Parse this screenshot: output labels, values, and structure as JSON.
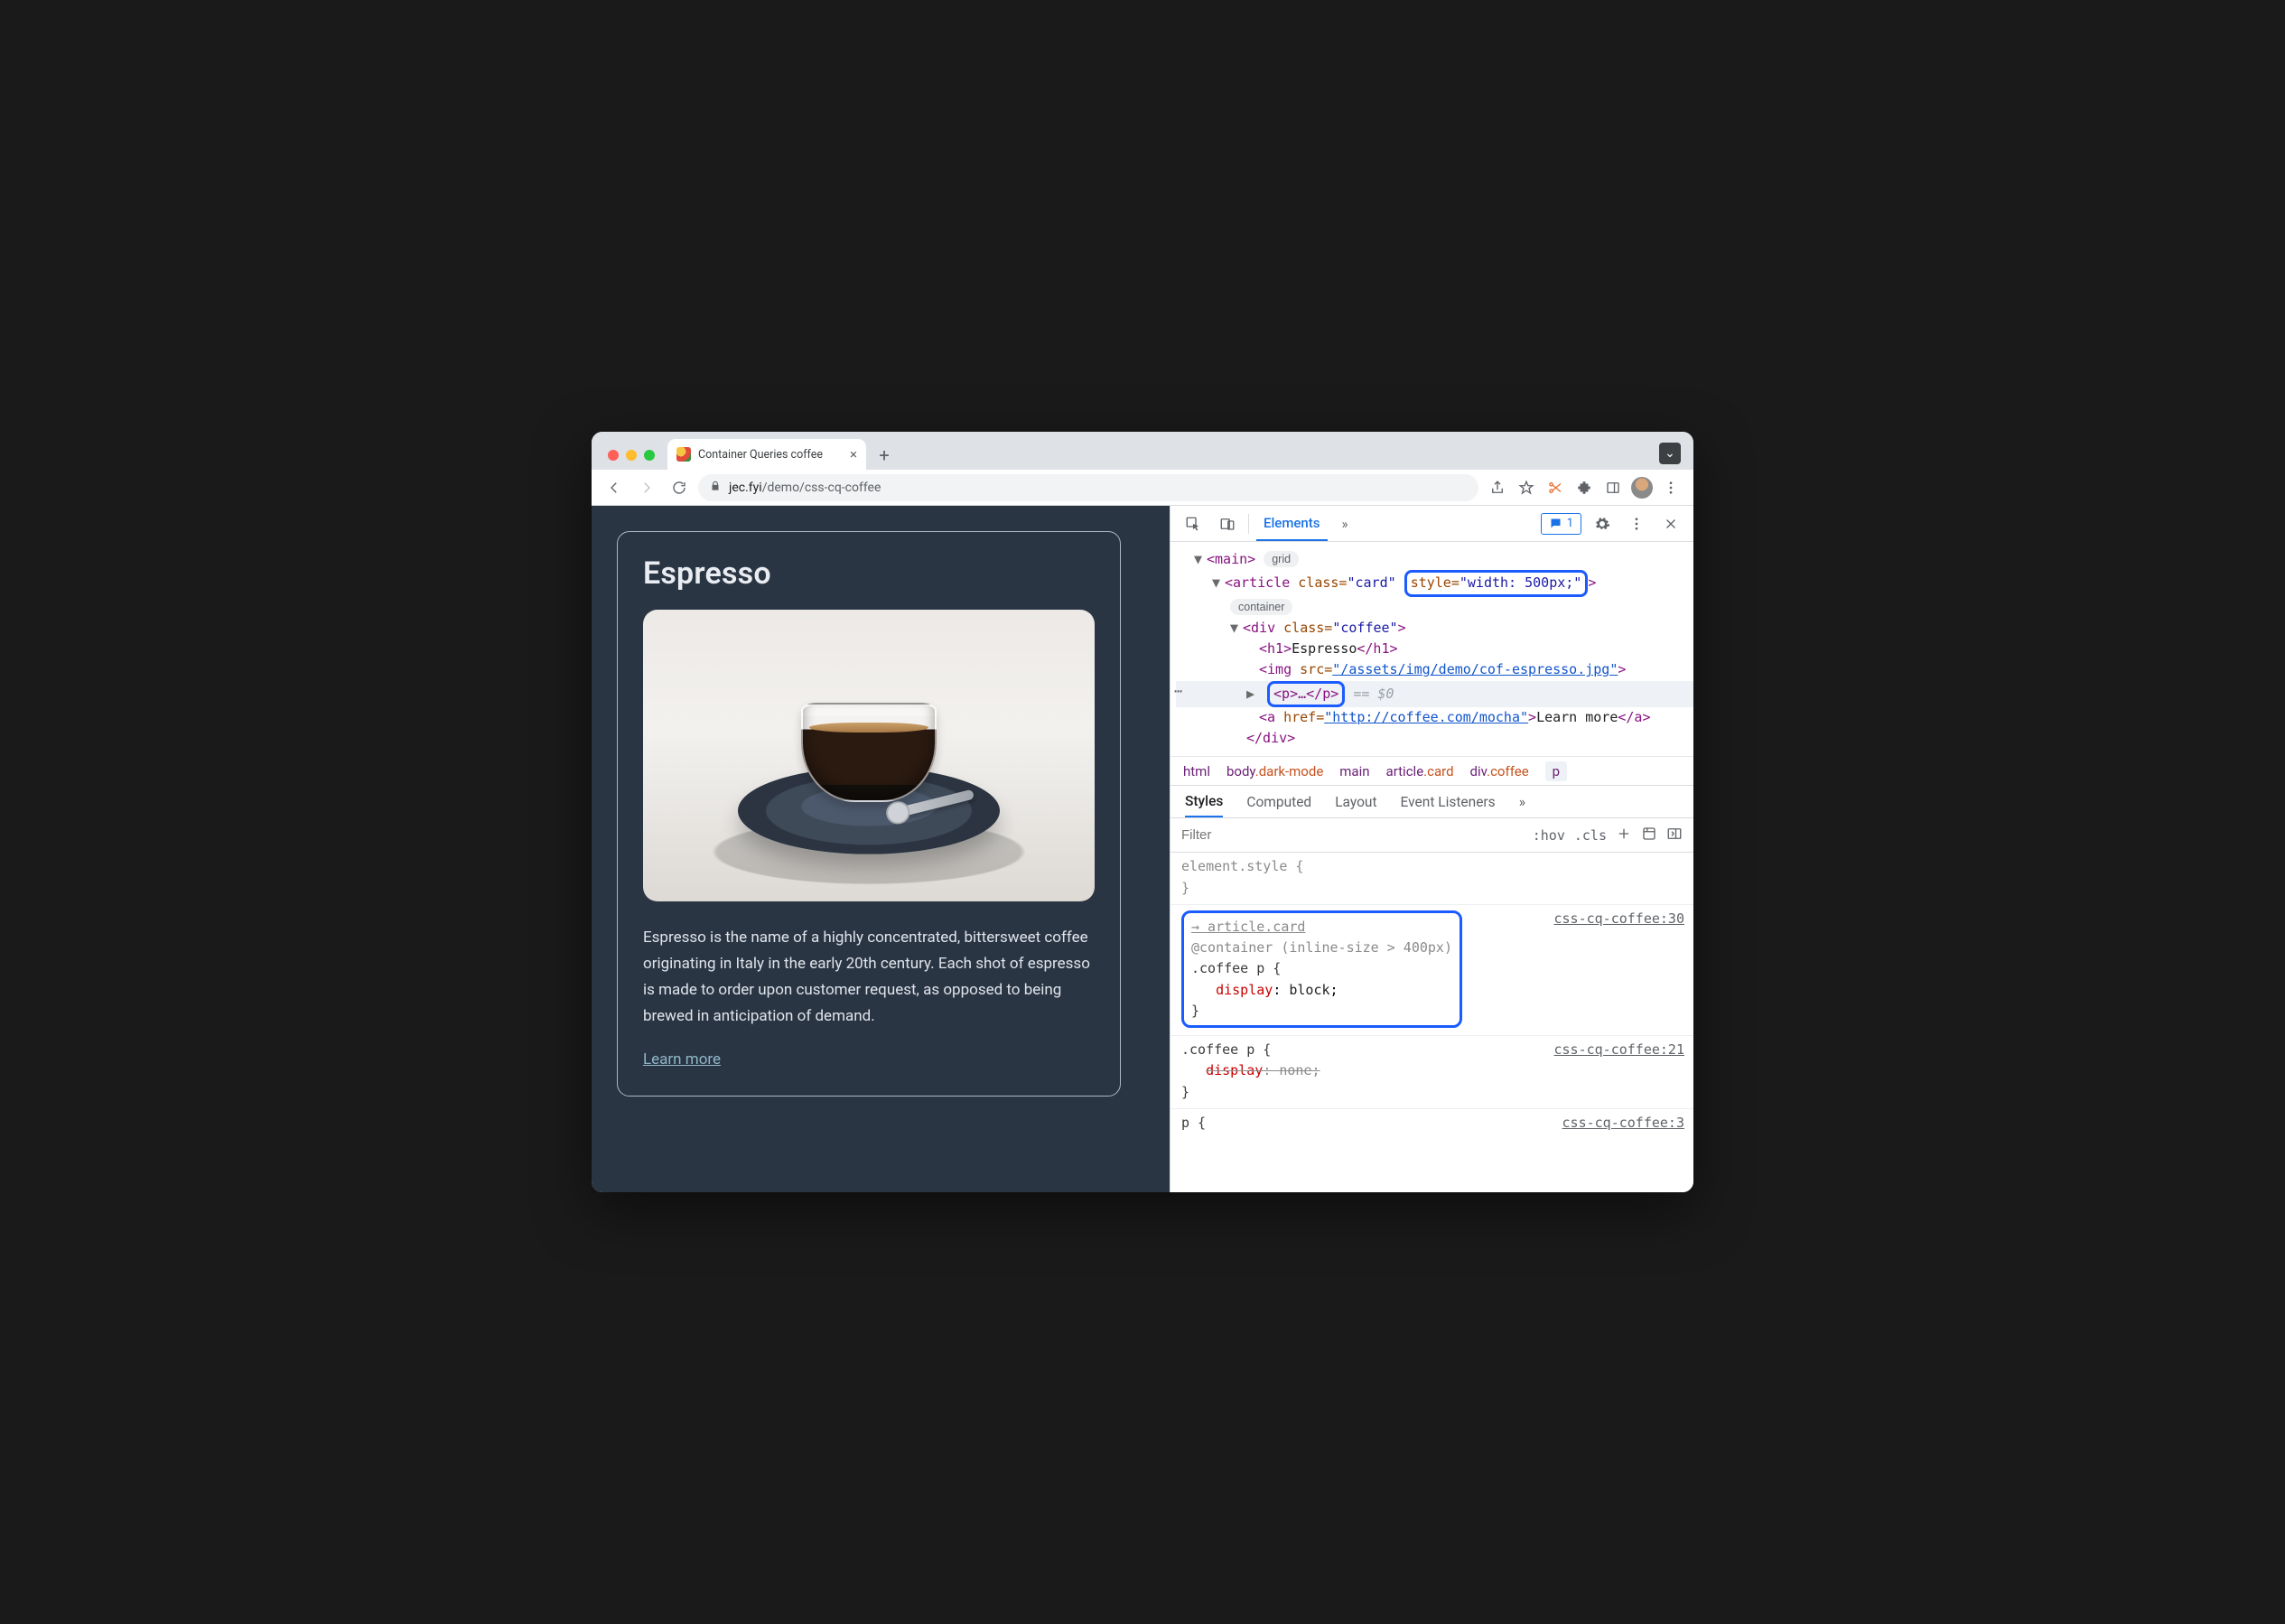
{
  "window": {
    "tab_title": "Container Queries coffee",
    "new_tab_glyph": "+",
    "tab_close_glyph": "×",
    "chevron_glyph": "⌄"
  },
  "toolbar": {
    "url_host": "jec.fyi",
    "url_path": "/demo/css-cq-coffee"
  },
  "page": {
    "title": "Espresso",
    "description": "Espresso is the name of a highly concentrated, bittersweet coffee originating in Italy in the early 20th century. Each shot of espresso is made to order upon customer request, as opposed to being brewed in anticipation of demand.",
    "link_label": "Learn more"
  },
  "devtools": {
    "tabs": {
      "elements": "Elements"
    },
    "issue_count": "1",
    "elements": {
      "main_open": "<main>",
      "grid_pill": "grid",
      "article_open_1": "<article ",
      "article_class_attr": "class=",
      "article_class_val": "\"card\"",
      "article_style_attr": "style=",
      "article_style_val": "\"width: 500px;\"",
      "article_open_end": ">",
      "container_pill": "container",
      "div_open": "<div ",
      "div_class_attr": "class=",
      "div_class_val": "\"coffee\"",
      "div_open_end": ">",
      "h1_open": "<h1>",
      "h1_text": "Espresso",
      "h1_close": "</h1>",
      "img_open": "<img ",
      "img_src_attr": "src=",
      "img_src_val": "\"/assets/img/demo/cof-espresso.jpg\"",
      "img_close": ">",
      "p_collapsed": "<p>…</p>",
      "p_eq": "== $0",
      "a_open": "<a ",
      "a_href_attr": "href=",
      "a_href_val": "\"http://coffee.com/mocha\"",
      "a_mid": ">",
      "a_text": "Learn more",
      "a_close": "</a>",
      "div_close": "</div>"
    },
    "crumbs": [
      "html",
      "body.dark-mode",
      "main",
      "article.card",
      "div.coffee",
      "p"
    ],
    "styles_tabs": {
      "styles": "Styles",
      "computed": "Computed",
      "layout": "Layout",
      "listeners": "Event Listeners"
    },
    "filter_placeholder": "Filter",
    "hov": ":hov",
    "cls": ".cls",
    "rules": {
      "elstyle_open": "element.style {",
      "elstyle_close": "}",
      "cq_inherit": "→ article.card",
      "cq_line": "@container (inline-size > 400px)",
      "cq_selector": ".coffee p {",
      "cq_prop": "display",
      "cq_val": "block",
      "close": "}",
      "src1": "css-cq-coffee:30",
      "r2_selector": ".coffee p {",
      "r2_prop": "display",
      "r2_val": "none",
      "src2": "css-cq-coffee:21",
      "r3_selector": "p {",
      "src3": "css-cq-coffee:3"
    }
  }
}
